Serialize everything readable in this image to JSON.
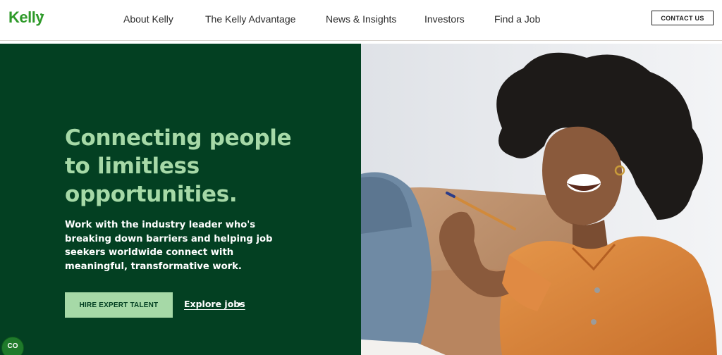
{
  "brand": {
    "logo_text": "Kelly",
    "accent": "#2f9a2a",
    "hero_bg": "#034022",
    "hero_accent": "#a6d9a7"
  },
  "nav": {
    "items": [
      {
        "label": "About Kelly"
      },
      {
        "label": "The Kelly Advantage"
      },
      {
        "label": "News & Insights"
      },
      {
        "label": "Investors"
      },
      {
        "label": "Find a Job"
      }
    ],
    "contact_label": "CONTACT US"
  },
  "hero": {
    "headline": "Connecting people to limitless opportunities.",
    "subhead": "Work with the industry leader who's breaking down barriers and helping job seekers worldwide connect with meaningful, transformative work.",
    "primary_cta": "HIRE EXPERT TALENT",
    "secondary_cta": "Explore jobs",
    "photo_icon": "smiling-woman-photo"
  },
  "chat": {
    "label": "CO",
    "icon": "chat-icon"
  }
}
